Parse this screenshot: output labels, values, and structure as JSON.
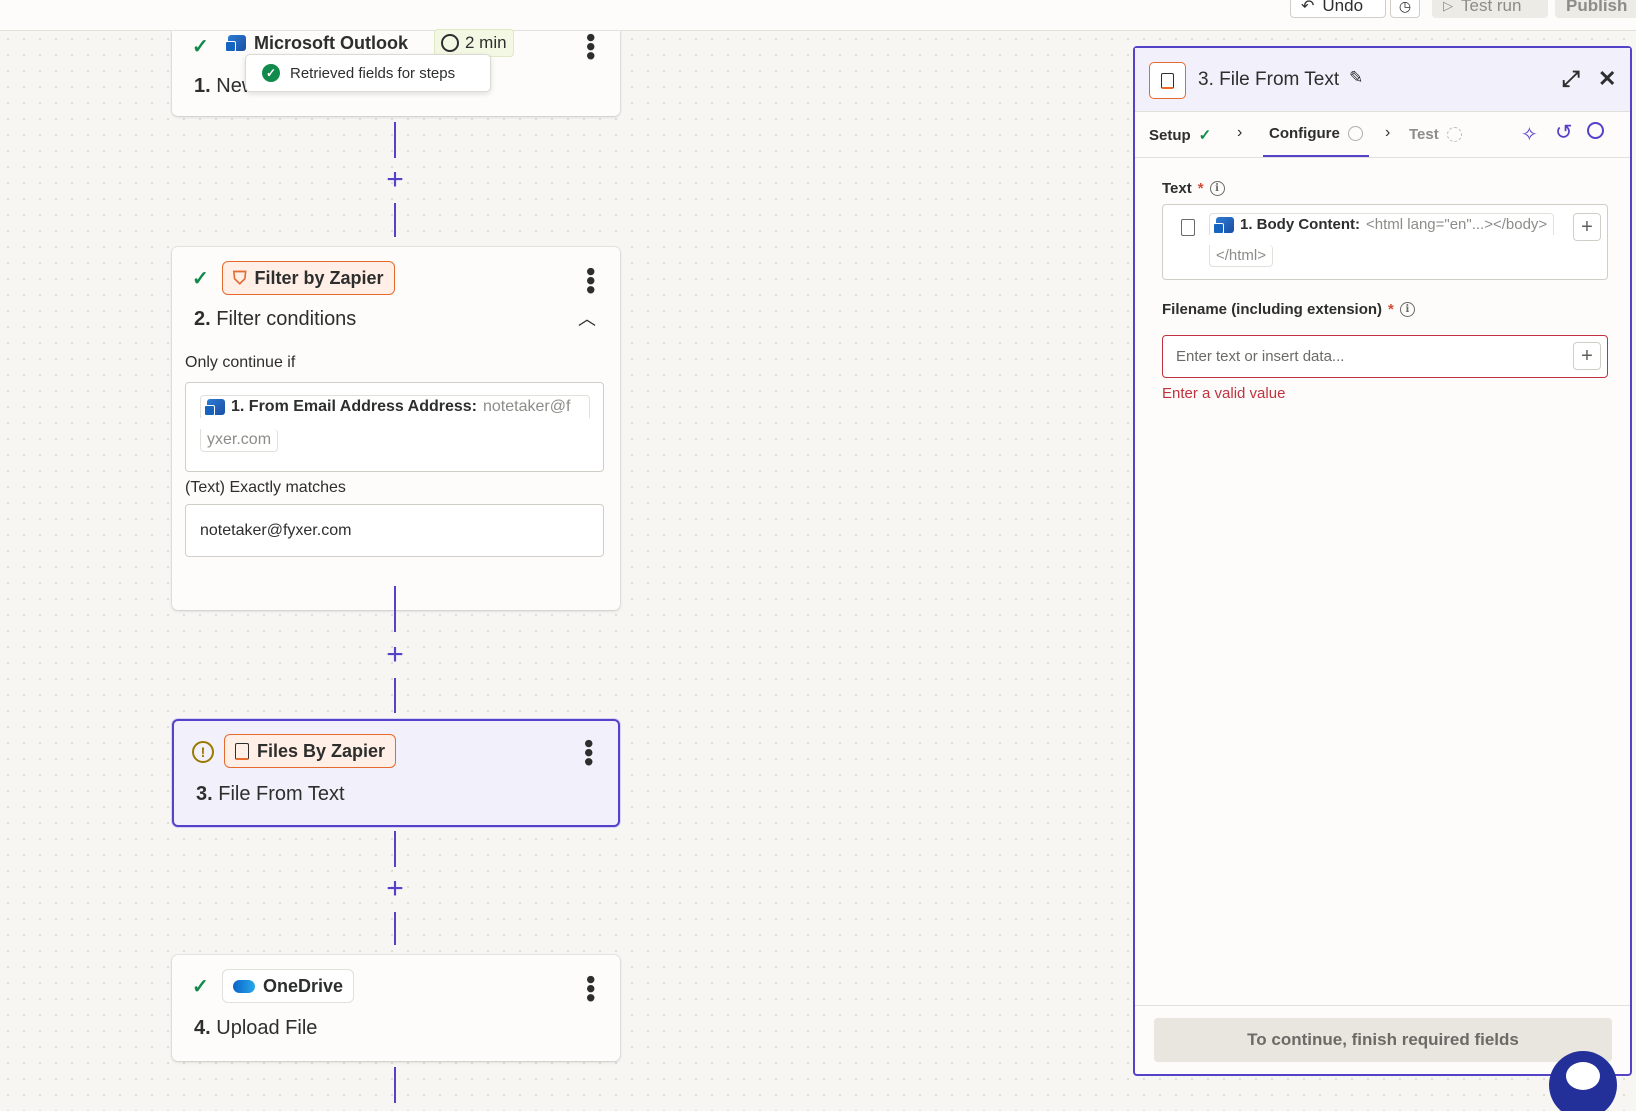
{
  "topbar": {
    "undo_label": "Undo",
    "test_run_label": "Test run",
    "publish_label": "Publish"
  },
  "toast": {
    "text": "Retrieved fields for steps"
  },
  "steps": [
    {
      "number": "1.",
      "title": "New Email",
      "app": "Microsoft Outlook",
      "badge": "2 min",
      "status": "complete"
    },
    {
      "number": "2.",
      "title": "Filter conditions",
      "app": "Filter by Zapier",
      "status": "complete",
      "condition_label": "Only continue if",
      "field_pill": "1. From Email Address Address:",
      "field_value": "notetaker@f",
      "field_value_cont": "yxer.com",
      "operator": "(Text) Exactly matches",
      "match_value": "notetaker@fyxer.com"
    },
    {
      "number": "3.",
      "title": "File From Text",
      "app": "Files By Zapier",
      "status": "warning"
    },
    {
      "number": "4.",
      "title": "Upload File",
      "app": "OneDrive",
      "status": "complete"
    }
  ],
  "panel": {
    "title": "3. File From Text",
    "tabs": [
      {
        "label": "Setup",
        "state": "complete"
      },
      {
        "label": "Configure",
        "state": "active"
      },
      {
        "label": "Test",
        "state": "pending"
      }
    ],
    "text_field": {
      "label": "Text",
      "required_mark": "*",
      "pill_label": "1. Body Content:",
      "pill_value": "<html lang=\"en\"...></body>",
      "pill_value_cont": "</html>"
    },
    "filename_field": {
      "label": "Filename (including extension)",
      "required_mark": "*",
      "placeholder": "Enter text or insert data...",
      "error": "Enter a valid value"
    },
    "footer_button": "To continue, finish required fields"
  },
  "colors": {
    "accent": "#5442c9",
    "success": "#128a4b",
    "warning": "#9a7a00",
    "error": "#c0323f",
    "orange": "#e46a2e"
  }
}
